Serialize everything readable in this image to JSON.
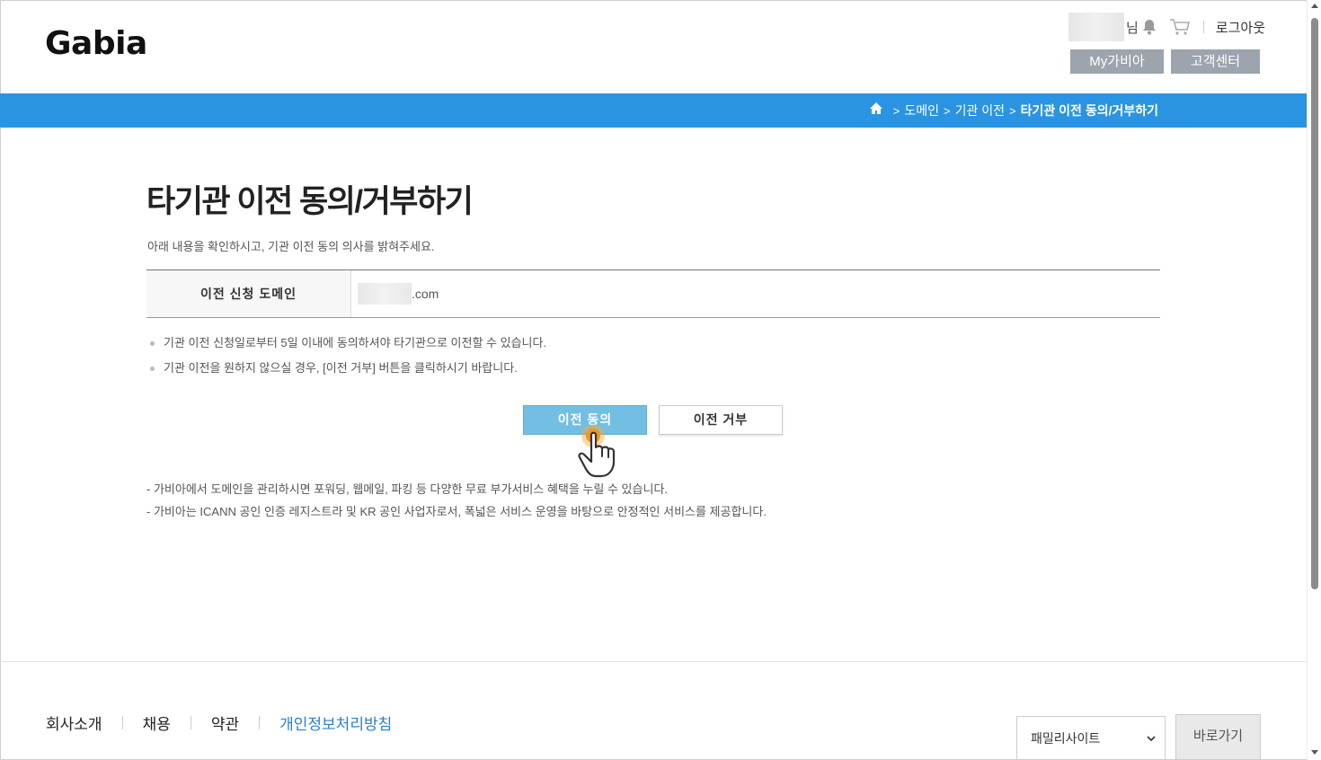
{
  "header": {
    "logo": "Gabia",
    "user_suffix": "님",
    "logout_label": "로그아웃",
    "my_label": "My가비아",
    "cs_label": "고객센터"
  },
  "breadcrumb": {
    "items": [
      "도메인",
      "기관 이전"
    ],
    "current": "타기관 이전 동의/거부하기",
    "separator": ">"
  },
  "main": {
    "title": "타기관 이전 동의/거부하기",
    "intro": "아래 내용을 확인하시고, 기관 이전 동의 의사를 밝혀주세요.",
    "table": {
      "header": "이전 신청 도메인",
      "domain_suffix": ".com"
    },
    "notes": [
      "기관 이전 신청일로부터 5일 이내에 동의하셔야 타기관으로 이전할 수 있습니다.",
      "기관 이전을 원하지 않으실 경우, [이전 거부] 버튼을 클릭하시기 바랍니다."
    ],
    "agree_label": "이전 동의",
    "reject_label": "이전 거부",
    "bottom_notes": [
      "- 가비아에서 도메인을 관리하시면 포워딩, 웹메일, 파킹 등 다양한 무료 부가서비스 혜택을 누릴 수 있습니다.",
      "- 가비아는 ICANN 공인 인증 레지스트라 및 KR 공인 사업자로서, 폭넓은 서비스 운영을 바탕으로 안정적인 서비스를 제공합니다."
    ]
  },
  "footer": {
    "links": [
      "회사소개",
      "채용",
      "약관",
      "개인정보처리방침"
    ],
    "family_select": "패밀리사이트",
    "go_label": "바로가기"
  },
  "colors": {
    "accent": "#2a94e3",
    "agree_button": "#73bfe3",
    "gray_button": "#9ca4ad"
  }
}
